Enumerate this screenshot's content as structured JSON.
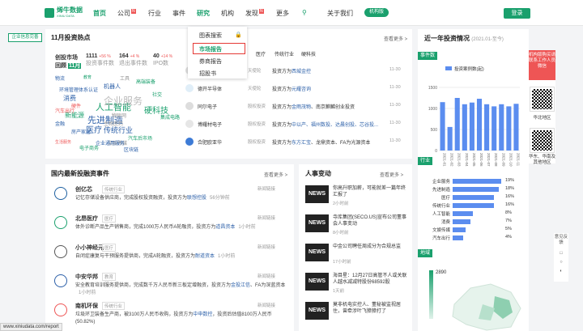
{
  "nav": {
    "brand": "烯牛数据",
    "brand_en": "XINIU DATA",
    "items": [
      "首页",
      "公司",
      "行业",
      "事件",
      "研究",
      "机构",
      "发现",
      "更多"
    ],
    "new_badge": "N",
    "about": "关于我们",
    "vip": "机构版",
    "login": "登录"
  },
  "dropdown": {
    "items": [
      "图表搜索",
      "市场报告",
      "券商报告",
      "招股书"
    ]
  },
  "left_btn": "企业信息完善",
  "hot": {
    "title": "11月投资热点",
    "more": "查看更多 >",
    "cols": [
      {
        "name": "创投市场",
        "sub": "回顾",
        "num": "11月"
      },
      {
        "num": "1111",
        "delta": "+56 %",
        "label": "投资事件数"
      },
      {
        "num": "164",
        "delta": "+4 %",
        "label": "退出事件数"
      },
      {
        "num": "40",
        "delta": "+14 %",
        "label": "IPO数"
      }
    ]
  },
  "cloud": [
    "人工智能",
    "企业服务",
    "先进制造",
    "硬科技",
    "医疗",
    "传统行业",
    "消费",
    "新能源",
    "汽车出行",
    "生物医药",
    "环境管理体系认证",
    "集成电路",
    "文娱传媒",
    "金融",
    "物联网",
    "电子商务",
    "区块链",
    "汽车后市场",
    "企业通用服务",
    "高端装备",
    "机器人",
    "生活服务",
    "物流",
    "教育",
    "房产家居",
    "硬件",
    "工具",
    "社交"
  ],
  "tabs": [
    "医疗",
    "传统行业",
    "硬科技"
  ],
  "hot_list": [
    {
      "name": "",
      "stage": "天使轮",
      "text": "投资方为",
      "link": "西城金控",
      "date": "11-30"
    },
    {
      "name": "德开半导体",
      "stage": "天使轮",
      "text": "投资方为",
      "link": "元耀咨询",
      "date": "11-30"
    },
    {
      "name": "同尔电子",
      "stage": "股权投资",
      "text": "投资方为",
      "link": "金雨茂物",
      "extra": "、南京麒麟创业投资",
      "date": "11-30"
    },
    {
      "name": "博耀材电子",
      "stage": "股权投资",
      "text": "投资方为",
      "link": "中以产、福州数投、达晨创投、芯谷投...",
      "date": "11-30"
    },
    {
      "name": "合肥欧亚华",
      "stage": "股权投资",
      "text": "投资方为",
      "link": "东方汇宝",
      "extra": "、龙鼎资本、FA为光源资本",
      "date": "11-30"
    }
  ],
  "domestic": {
    "title": "国内最新投融资事件",
    "more": "查看更多 >",
    "items": [
      {
        "name": "创亿芯",
        "tag": "传统行业",
        "news": "新闻链接",
        "desc": "记忆存储设备供应商，完成股权投资融资，投资方为",
        "link": "联想控股",
        "time": "56分钟前"
      },
      {
        "name": "北昂医疗",
        "tag": "医疗",
        "news": "新闻链接",
        "desc": "体外诊断产品生产销售商，完成1000万人民币A轮融资，投资方为",
        "link": "道昌资本",
        "time": "1小时前"
      },
      {
        "name": "小小神经元",
        "tag": "医疗",
        "news": "新闻链接",
        "desc": "自闭症康复与干预服务提供商，完成A轮融资，投资方为",
        "link": "耐道资本",
        "time": "1小时前"
      },
      {
        "name": "中安华邦",
        "tag": "教育",
        "news": "新闻链接",
        "desc": "安全教育培训服务提供商，完成数千万人民币新三板定增融资，投资方为",
        "link": "金投江信",
        "desc2": "、FA为深蓝资本",
        "time": "1小时前"
      },
      {
        "name": "南机环保",
        "tag": "传统行业",
        "news": "新闻链接",
        "desc": "垃圾环卫装备生产商，被3100万人民币收购，投资方为",
        "link": "中申数控",
        "desc2": "，投资后估值8100万人民币(50.82%)",
        "time": ""
      }
    ]
  },
  "people": {
    "title": "人事变动",
    "more": "查看更多 >",
    "items": [
      {
        "text": "你高升职加薪，可能就差一篇年终汇报了",
        "time": "2小时前"
      },
      {
        "text": "寺库集团(SECO.US)宣布公司董事会人事变动",
        "time": "8小时前"
      },
      {
        "text": "中金公司聘任周成分为合规总监",
        "time": "17小时前"
      },
      {
        "text": "海目星：12月27日高管不人或关联人越水减减特股份68592股",
        "time": "1天前"
      },
      {
        "text": "莫非机电实控人、董秘被监视居住，曾牵涉叶飞獐獐打了",
        "time": ""
      }
    ]
  },
  "year": {
    "title": "近一年投资情况",
    "sub": "(2021.01-至今)"
  },
  "chart_data": [
    {
      "type": "bar",
      "legend": "投资案例数(起)",
      "categories": [
        "2021-01",
        "2021-02",
        "2021-03",
        "2021-04",
        "2021-05",
        "2021-06",
        "2021-07",
        "2021-08",
        "2021-09",
        "2021-10",
        "2021-11"
      ],
      "values": [
        1150,
        560,
        1250,
        1100,
        1140,
        1230,
        1100,
        1050,
        1100,
        1050,
        1110
      ],
      "ylim": [
        0,
        1500
      ]
    },
    {
      "type": "bar",
      "categories": [
        "企业服务",
        "先进制造",
        "医疗",
        "传统行业",
        "人工智能",
        "消费",
        "文娱传媒",
        "汽车出行"
      ],
      "values": [
        19,
        18,
        16,
        16,
        8,
        7,
        5,
        4
      ],
      "labels": [
        "19%",
        "18%",
        "16%",
        "16%",
        "8%",
        "7%",
        "5%",
        "4%"
      ]
    }
  ],
  "side": {
    "tab_count": "事件数",
    "tab_industry": "行业",
    "tab_region": "地域",
    "promo": "机构版购买请联系工作人员微信",
    "north": "华北地区",
    "south": "华东、华南及其他地区",
    "map_value": "2890"
  },
  "float": {
    "feedback": "意见反馈"
  },
  "url": "www.xiniudata.com/report"
}
